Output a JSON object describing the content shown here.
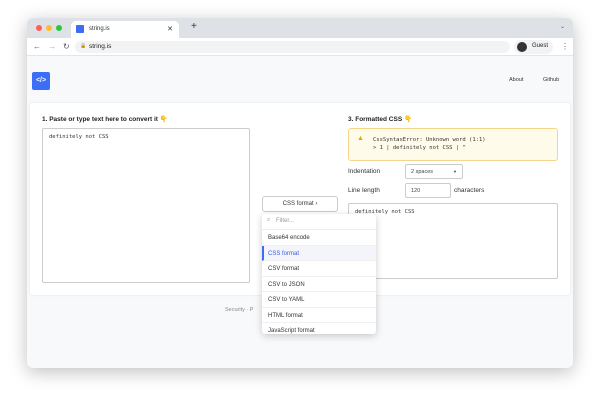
{
  "browser": {
    "tab_title": "string.is",
    "url": "string.is",
    "profile": "Guest"
  },
  "header": {
    "logo": "</>",
    "links": [
      "About",
      "Github"
    ]
  },
  "input": {
    "heading": "1. Paste or type text here to convert it 👇",
    "value": "definitely not CSS"
  },
  "converter": {
    "button_label": "CSS format",
    "filter_placeholder": "Filter...",
    "items": [
      "Base64 encode",
      "CSS format",
      "CSV format",
      "CSV to JSON",
      "CSV to YAML",
      "HTML format",
      "JavaScript format"
    ],
    "selected": "CSS format"
  },
  "output": {
    "heading": "3. Formatted CSS 👇",
    "error_line1": "CssSyntaxError: Unknown word (1:1)",
    "error_line2": "> 1 | definitely not CSS | ^",
    "indentation_label": "Indentation",
    "indentation_value": "2 spaces",
    "line_length_label": "Line length",
    "line_length_value": "120",
    "line_length_unit": "characters",
    "value": "definitely not CSS"
  },
  "footer": {
    "text": "Security · P"
  },
  "colors": {
    "accent": "#3b6ef5",
    "warning_bg": "#fffbeb",
    "warning_border": "#f5d58a"
  }
}
